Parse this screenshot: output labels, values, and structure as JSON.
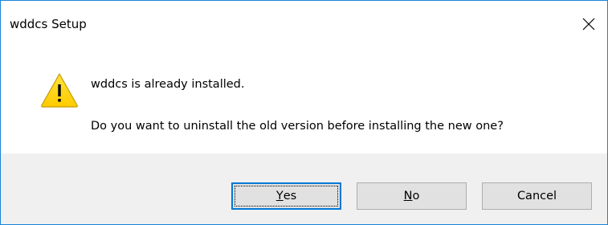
{
  "window": {
    "title": "wddcs Setup",
    "close_icon": "close-icon"
  },
  "message": {
    "icon": "warning-icon",
    "line1": "wddcs is already installed.",
    "line2": "Do you want to uninstall the old version before installing the new one?"
  },
  "buttons": {
    "yes": {
      "mnemonic": "Y",
      "rest": "es",
      "default": true
    },
    "no": {
      "mnemonic": "N",
      "rest": "o"
    },
    "cancel": {
      "label": "Cancel"
    }
  },
  "colors": {
    "border_accent": "#1883d7",
    "footer_bg": "#f0f0f0",
    "button_bg": "#e1e1e1",
    "warning_yellow": "#ffd800"
  }
}
